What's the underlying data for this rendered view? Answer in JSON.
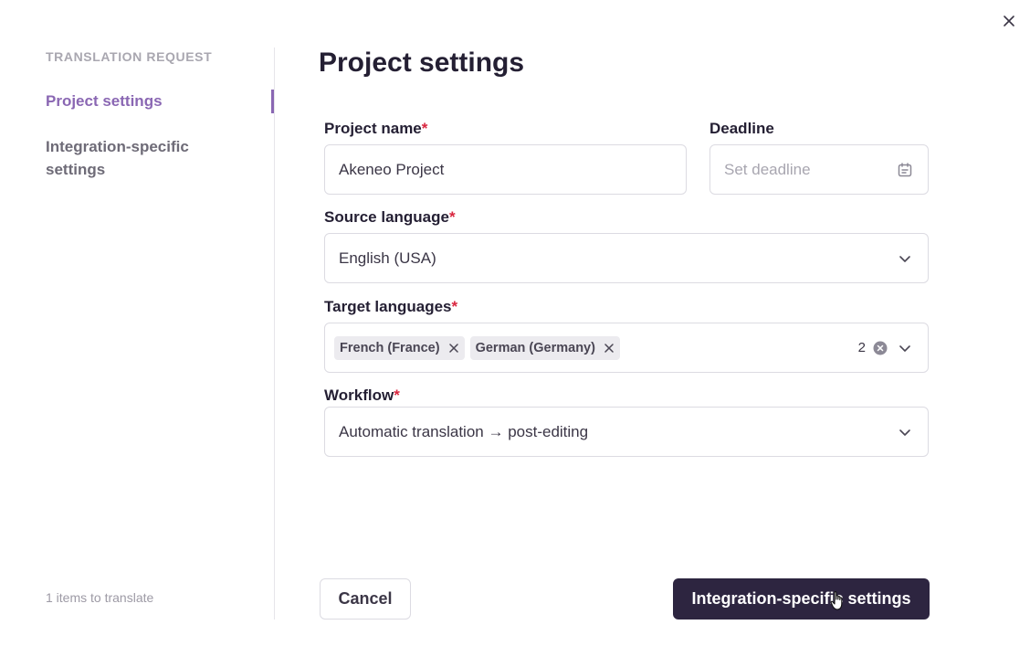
{
  "dialog": {
    "close_icon": "close-icon"
  },
  "sidebar": {
    "heading": "TRANSLATION REQUEST",
    "items": [
      {
        "label": "Project settings",
        "active": true
      },
      {
        "label": "Integration-specific settings",
        "active": false
      }
    ],
    "items_count": "1 items to translate"
  },
  "main": {
    "title": "Project settings",
    "project_name": {
      "label": "Project name",
      "required": "*",
      "value": "Akeneo Project"
    },
    "deadline": {
      "label": "Deadline",
      "placeholder": "Set deadline",
      "icon": "calendar-icon"
    },
    "source_language": {
      "label": "Source language",
      "required": "*",
      "value": "English (USA)"
    },
    "target_languages": {
      "label": "Target languages",
      "required": "*",
      "tags": [
        "French (France)",
        "German (Germany)"
      ],
      "count": "2"
    },
    "workflow": {
      "label": "Workflow",
      "required": "*",
      "value": "Automatic translation → post-editing"
    }
  },
  "footer": {
    "cancel_label": "Cancel",
    "next_label": "Integration-specific settings"
  },
  "colors": {
    "accent": "#8a67b3",
    "primary_button": "#2d2540",
    "required": "#d9263f"
  }
}
